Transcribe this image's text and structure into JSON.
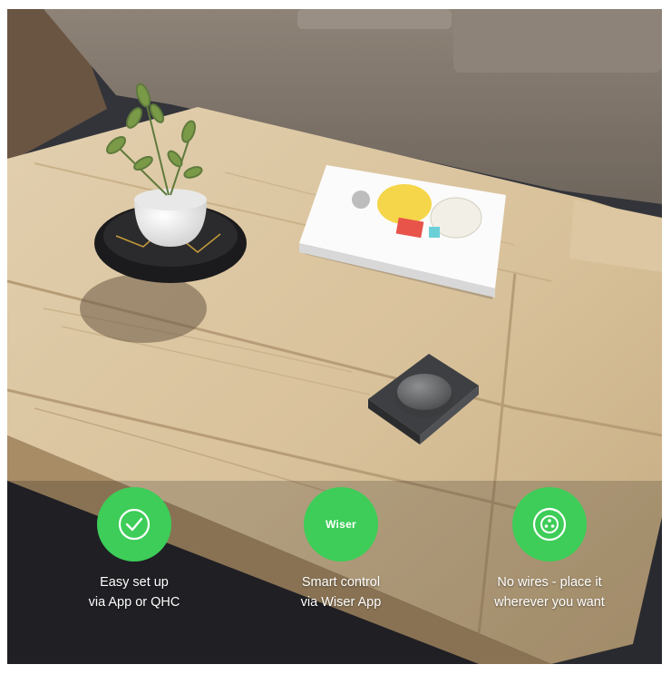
{
  "features": [
    {
      "icon": "checkmark-icon",
      "line1": "Easy set up",
      "line2": "via App or QHC"
    },
    {
      "icon": "wiser-logo",
      "logo_text": "Wiser",
      "line1": "Smart control",
      "line2": "via Wiser App"
    },
    {
      "icon": "wireless-dial-icon",
      "line1": "No wires - place it",
      "line2": "wherever you want"
    }
  ],
  "colors": {
    "badge_green": "#3dcd58",
    "caption_text": "#ffffff"
  }
}
